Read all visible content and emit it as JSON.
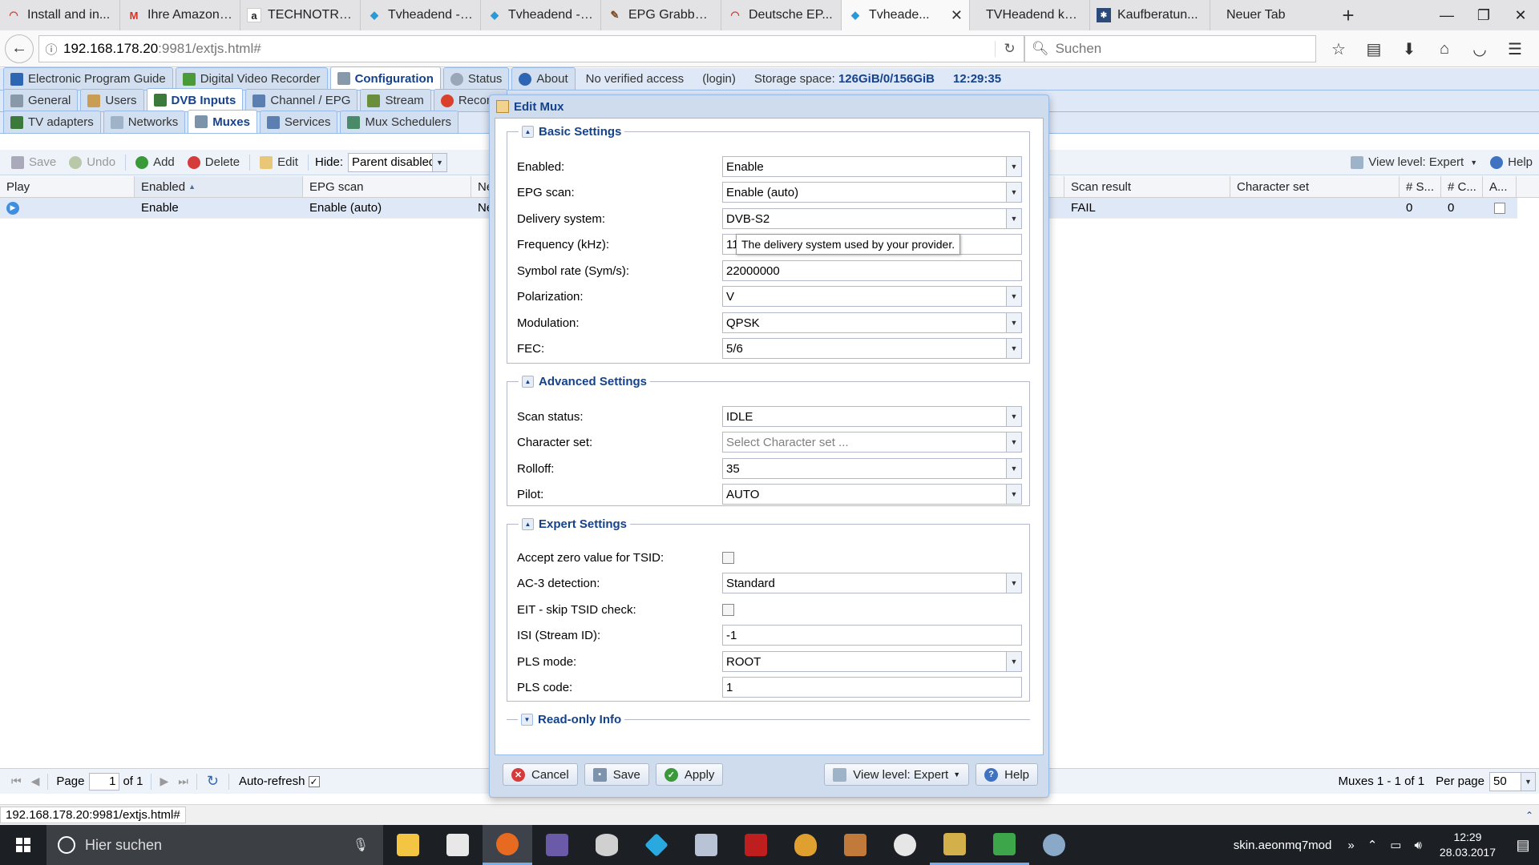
{
  "browser": {
    "tabs": [
      {
        "title": "Install and in...",
        "icon": "red-arc-icon",
        "color": "#d63b3b"
      },
      {
        "title": "Ihre Amazon....",
        "icon": "gmail-icon",
        "color": "#d93025"
      },
      {
        "title": "TECHNOTRE...",
        "icon": "amazon-icon",
        "color": "#222222"
      },
      {
        "title": "Tvheadend - ...",
        "icon": "tvheadend-icon",
        "color": "#2a9ad6"
      },
      {
        "title": "Tvheadend - ...",
        "icon": "tvheadend-icon",
        "color": "#2a9ad6"
      },
      {
        "title": "EPG Grabber...",
        "icon": "forum-icon",
        "color": "#7a4b2a"
      },
      {
        "title": "Deutsche EP...",
        "icon": "red-arc-icon",
        "color": "#d63b3b"
      },
      {
        "title": "Tvheade...",
        "icon": "tvheadend-icon",
        "color": "#2a9ad6",
        "active": true
      },
      {
        "title": "TVHeadend konfi...",
        "icon": "none",
        "color": "#ffffff"
      },
      {
        "title": "Kaufberatun...",
        "icon": "site-icon",
        "color": "#2b4a7a"
      },
      {
        "title": "Neuer Tab",
        "icon": "none",
        "color": "#ffffff"
      }
    ],
    "url_host": "192.168.178.20",
    "url_path": ":9981/extjs.html#",
    "search_placeholder": "Suchen"
  },
  "app": {
    "main_tabs": [
      "Electronic Program Guide",
      "Digital Video Recorder",
      "Configuration",
      "Status",
      "About"
    ],
    "access_text": "No verified access",
    "login_text": "(login)",
    "storage_label": "Storage space:",
    "storage_value": "126GiB/0/156GiB",
    "time": "12:29:35",
    "config_tabs": [
      "General",
      "Users",
      "DVB Inputs",
      "Channel / EPG",
      "Stream",
      "Recordi"
    ],
    "dvb_tabs": [
      "TV adapters",
      "Networks",
      "Muxes",
      "Services",
      "Mux Schedulers"
    ],
    "toolbar": {
      "save": "Save",
      "undo": "Undo",
      "add": "Add",
      "delete": "Delete",
      "edit": "Edit",
      "hide_label": "Hide:",
      "hide_value": "Parent disabled",
      "view_level": "View level: Expert",
      "help": "Help"
    },
    "grid": {
      "headers_left": [
        "Play",
        "Enabled",
        "EPG scan",
        "Ne"
      ],
      "headers_right": [
        "Scan result",
        "Character set",
        "# S...",
        "# C...",
        "A..."
      ],
      "row": {
        "enabled": "Enable",
        "epg_scan": "Enable (auto)",
        "network": "Ne",
        "scan_result": "FAIL",
        "services": "0",
        "channels": "0"
      }
    },
    "pager": {
      "page_label": "Page",
      "page_value": "1",
      "of_label": "of 1",
      "auto_refresh": "Auto-refresh",
      "summary": "Muxes 1 - 1 of 1",
      "per_page_label": "Per page",
      "per_page_value": "50"
    },
    "status_url": "192.168.178.20:9981/extjs.html#"
  },
  "modal": {
    "title": "Edit Mux",
    "sections": {
      "basic": "Basic Settings",
      "advanced": "Advanced Settings",
      "expert": "Expert Settings",
      "readonly": "Read-only Info"
    },
    "fields": {
      "enabled": {
        "label": "Enabled:",
        "value": "Enable"
      },
      "epg_scan": {
        "label": "EPG scan:",
        "value": "Enable (auto)"
      },
      "delivery": {
        "label": "Delivery system:",
        "value": "DVB-S2"
      },
      "frequency": {
        "label": "Frequency (kHz):",
        "value": "11"
      },
      "symbol_rate": {
        "label": "Symbol rate (Sym/s):",
        "value": "22000000"
      },
      "polarization": {
        "label": "Polarization:",
        "value": "V"
      },
      "modulation": {
        "label": "Modulation:",
        "value": "QPSK"
      },
      "fec": {
        "label": "FEC:",
        "value": "5/6"
      },
      "scan_status": {
        "label": "Scan status:",
        "value": "IDLE"
      },
      "charset": {
        "label": "Character set:",
        "placeholder": "Select Character set ..."
      },
      "rolloff": {
        "label": "Rolloff:",
        "value": "35"
      },
      "pilot": {
        "label": "Pilot:",
        "value": "AUTO"
      },
      "tsid_zero": {
        "label": "Accept zero value for TSID:"
      },
      "ac3": {
        "label": "AC-3 detection:",
        "value": "Standard"
      },
      "eit_skip": {
        "label": "EIT - skip TSID check:"
      },
      "isi": {
        "label": "ISI (Stream ID):",
        "value": "-1"
      },
      "pls_mode": {
        "label": "PLS mode:",
        "value": "ROOT"
      },
      "pls_code": {
        "label": "PLS code:",
        "value": "1"
      }
    },
    "tooltip": "The delivery system used by your provider.",
    "buttons": {
      "cancel": "Cancel",
      "save": "Save",
      "apply": "Apply",
      "view_level": "View level: Expert",
      "help": "Help"
    }
  },
  "taskbar": {
    "search_placeholder": "Hier suchen",
    "tray_text": "skin.aeonmq7mod",
    "time": "12:29",
    "date": "28.03.2017"
  }
}
